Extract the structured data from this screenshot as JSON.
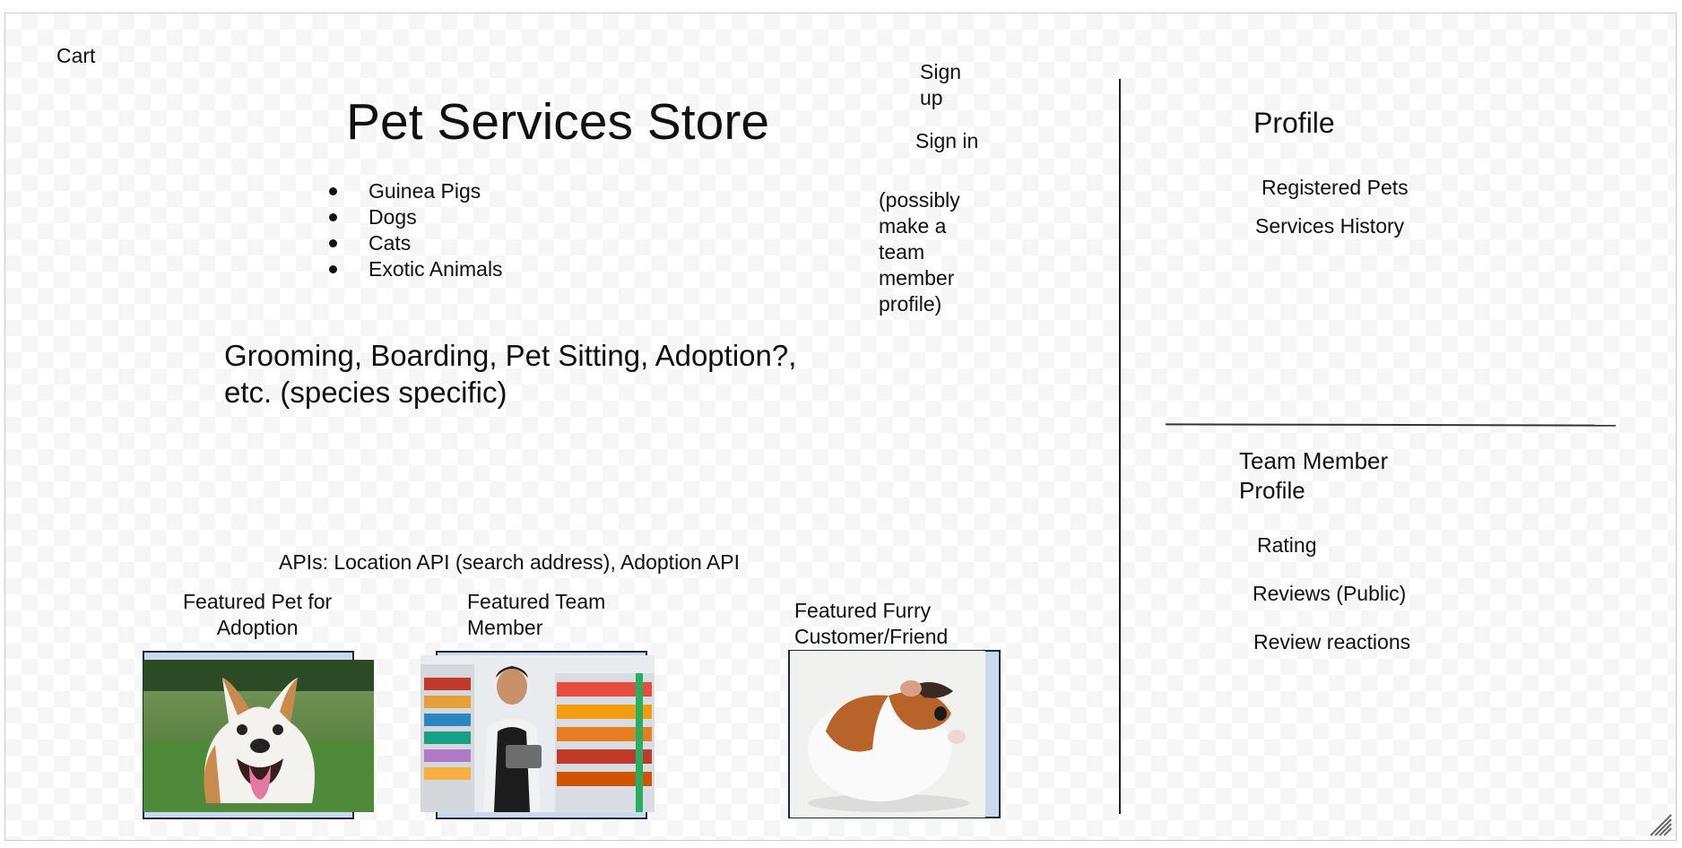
{
  "header": {
    "cart_label": "Cart",
    "signup_line1": "Sign",
    "signup_line2": "up",
    "signin_label": "Sign in",
    "note_lines": [
      "(possibly",
      "make a",
      "team",
      "member",
      "profile)"
    ]
  },
  "main": {
    "title": "Pet Services Store",
    "species": [
      "Guinea Pigs",
      "Dogs",
      "Cats",
      "Exotic Animals"
    ],
    "services_line1": "Grooming, Boarding, Pet Sitting, Adoption?,",
    "services_line2": "etc. (species specific)",
    "apis": "APIs: Location API (search address), Adoption API"
  },
  "featured": {
    "pet_line1": "Featured Pet for",
    "pet_line2": "Adoption",
    "team_line1": "Featured Team",
    "team_line2": "Member",
    "customer_line1": "Featured Furry",
    "customer_line2": "Customer/Friend"
  },
  "profile": {
    "title": "Profile",
    "registered_pets": "Registered Pets",
    "services_history": "Services History"
  },
  "team_profile": {
    "title_line1": "Team Member",
    "title_line2": "Profile",
    "rating": "Rating",
    "reviews": "Reviews (Public)",
    "review_reactions": "Review reactions"
  },
  "colors": {
    "frame_border": "#c9ccd1",
    "checker": "#f6f6f6",
    "image_frame": "#c9d9ee",
    "grass": "#4f8a3a",
    "store_shelf": "#d9dde3",
    "guinea_orange": "#b8632a"
  }
}
